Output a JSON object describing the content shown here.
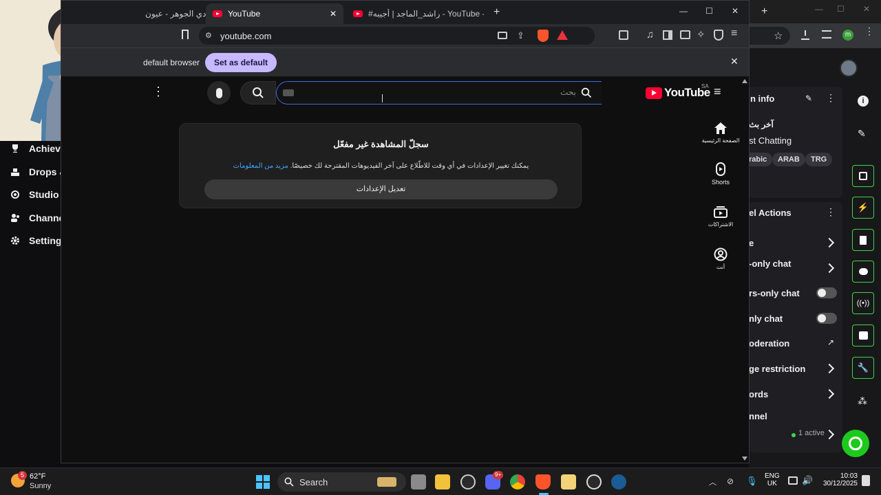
{
  "twitch_left": {
    "nav_items": [
      {
        "label": "Achiev",
        "icon": "trophy-icon"
      },
      {
        "label": "Drops &",
        "icon": "drops-icon"
      },
      {
        "label": "Studio",
        "icon": "studio-icon"
      },
      {
        "label": "Channe",
        "icon": "channel-icon"
      },
      {
        "label": "Setting",
        "icon": "gear-icon"
      }
    ]
  },
  "twitch_right": {
    "stream_info_title": "n info",
    "stream_title_partial": "آخر بث",
    "category": "st Chatting",
    "tags": [
      "rabic",
      "ARAB",
      "TRG"
    ],
    "actions_title": "el Actions",
    "action_rows": [
      {
        "label": "e",
        "control": "chevron"
      },
      {
        "label": "-only chat",
        "control": "chevron"
      },
      {
        "label": "rs-only chat",
        "control": "toggle"
      },
      {
        "label": "nly chat",
        "control": "toggle"
      },
      {
        "label": "oderation",
        "control": "external"
      },
      {
        "label": "ge restriction",
        "control": "chevron"
      },
      {
        "label": "ords",
        "control": "chevron"
      },
      {
        "label": "nnel",
        "control": "none"
      }
    ],
    "active_count": "1 active",
    "accent_color": "#3dd54a"
  },
  "brave": {
    "tabs": [
      {
        "label": "عبادي الجوهر - عيون",
        "active": false
      },
      {
        "label": "YouTube",
        "active": true
      },
      {
        "label": "#راشد_الماجد | أجيبه - YouTube - bah",
        "active": false
      }
    ],
    "new_tab_symbol": "+",
    "url": "youtube.com",
    "infobar_text": "default browser",
    "infobar_button": "Set as default",
    "window_controls": [
      "—",
      "☐",
      "✕"
    ]
  },
  "youtube": {
    "logo_text": "YouTube",
    "region": "SA",
    "search_placeholder": "بحث",
    "history_title": "سجلّ المشاهدة غير مفعّل",
    "history_body": "يمكنك تغيير الإعدادات في أي وقت للاطّلاع على آخر الفيديوهات المقترحة لك خصيصًا.",
    "history_link": "مزيد من المعلومات",
    "history_button": "تعديل الإعدادات",
    "side_nav": [
      {
        "label": "الصفحة الرئيسية",
        "icon": "home-icon"
      },
      {
        "label": "Shorts",
        "icon": "shorts-icon"
      },
      {
        "label": "الاشتراكات",
        "icon": "subscriptions-icon"
      },
      {
        "label": "أنت",
        "icon": "you-icon"
      }
    ]
  },
  "taskbar": {
    "weather_temp": "62°F",
    "weather_desc": "Sunny",
    "weather_badge": "5",
    "search_label": "Search",
    "lang_top": "ENG",
    "lang_bottom": "UK",
    "time": "10:03",
    "date": "30/12/2025",
    "discord_badge": "9+"
  }
}
